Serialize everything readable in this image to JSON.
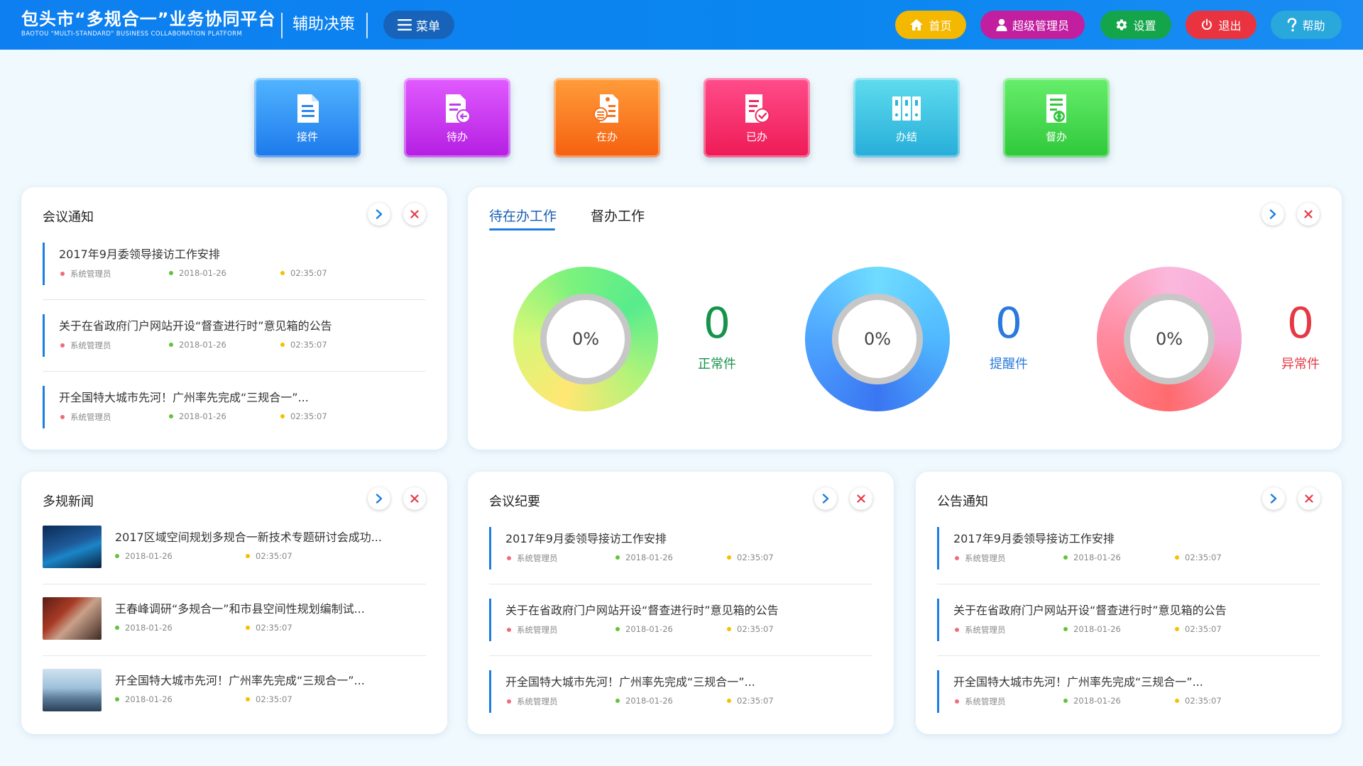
{
  "header": {
    "brand_cn": "包头市“多规合一”业务协同平台",
    "brand_en": "BAOTOU \"MULTI-STANDARD\" BUSINESS COLLABORATION PLATFORM",
    "module": "辅助决策",
    "menu": "菜单",
    "buttons": [
      {
        "label": "首页",
        "icon": "home-icon",
        "color": "#f5b800"
      },
      {
        "label": "超级管理员",
        "icon": "user-icon",
        "color": "#c21ea0"
      },
      {
        "label": "设置",
        "icon": "gear-icon",
        "color": "#14a54b"
      },
      {
        "label": "退出",
        "icon": "power-icon",
        "color": "#e9343f"
      },
      {
        "label": "帮助",
        "icon": "help-icon",
        "color": "#2aa7db"
      }
    ]
  },
  "quick": [
    {
      "label": "接件",
      "icon": "document-icon"
    },
    {
      "label": "待办",
      "icon": "pending-doc-icon"
    },
    {
      "label": "在办",
      "icon": "processing-doc-icon"
    },
    {
      "label": "已办",
      "icon": "done-doc-icon"
    },
    {
      "label": "办结",
      "icon": "archive-icon"
    },
    {
      "label": "督办",
      "icon": "supervise-icon"
    }
  ],
  "meeting_notice": {
    "title": "会议通知",
    "items": [
      {
        "title": "2017年9月委领导接访工作安排",
        "author": "系统管理员",
        "date": "2018-01-26",
        "time": "02:35:07"
      },
      {
        "title": "关于在省政府门户网站开设“督查进行时”意见箱的公告",
        "author": "系统管理员",
        "date": "2018-01-26",
        "time": "02:35:07"
      },
      {
        "title": "开全国特大城市先河！广州率先完成“三规合一”...",
        "author": "系统管理员",
        "date": "2018-01-26",
        "time": "02:35:07"
      }
    ]
  },
  "work": {
    "tabs": [
      "待在办工作",
      "督办工作"
    ],
    "stats": [
      {
        "percent": "0%",
        "count": "0",
        "label": "正常件",
        "color": "#16934a",
        "progress": 0
      },
      {
        "percent": "0%",
        "count": "0",
        "label": "提醒件",
        "color": "#2b79dc",
        "progress": 0
      },
      {
        "percent": "0%",
        "count": "0",
        "label": "异常件",
        "color": "#e53a45",
        "progress": 0
      }
    ]
  },
  "news": {
    "title": "多规新闻",
    "items": [
      {
        "title": "2017区域空间规划多规合一新技术专题研讨会成功...",
        "date": "2018-01-26",
        "time": "02:35:07"
      },
      {
        "title": "王春峰调研“多规合一”和市县空间性规划编制试...",
        "date": "2018-01-26",
        "time": "02:35:07"
      },
      {
        "title": "开全国特大城市先河！广州率先完成“三规合一”...",
        "date": "2018-01-26",
        "time": "02:35:07"
      }
    ]
  },
  "minutes": {
    "title": "会议纪要",
    "items": [
      {
        "title": "2017年9月委领导接访工作安排",
        "author": "系统管理员",
        "date": "2018-01-26",
        "time": "02:35:07"
      },
      {
        "title": "关于在省政府门户网站开设“督查进行时”意见箱的公告",
        "author": "系统管理员",
        "date": "2018-01-26",
        "time": "02:35:07"
      },
      {
        "title": "开全国特大城市先河！广州率先完成“三规合一”...",
        "author": "系统管理员",
        "date": "2018-01-26",
        "time": "02:35:07"
      }
    ]
  },
  "announce": {
    "title": "公告通知",
    "items": [
      {
        "title": "2017年9月委领导接访工作安排",
        "author": "系统管理员",
        "date": "2018-01-26",
        "time": "02:35:07"
      },
      {
        "title": "关于在省政府门户网站开设“督查进行时”意见箱的公告",
        "author": "系统管理员",
        "date": "2018-01-26",
        "time": "02:35:07"
      },
      {
        "title": "开全国特大城市先河！广州率先完成“三规合一”...",
        "author": "系统管理员",
        "date": "2018-01-26",
        "time": "02:35:07"
      }
    ]
  },
  "colors": {
    "accent": "#1a7fe0",
    "author_dot": "#f26b7a",
    "date_dot": "#66c23a",
    "time_dot": "#f5c000"
  }
}
